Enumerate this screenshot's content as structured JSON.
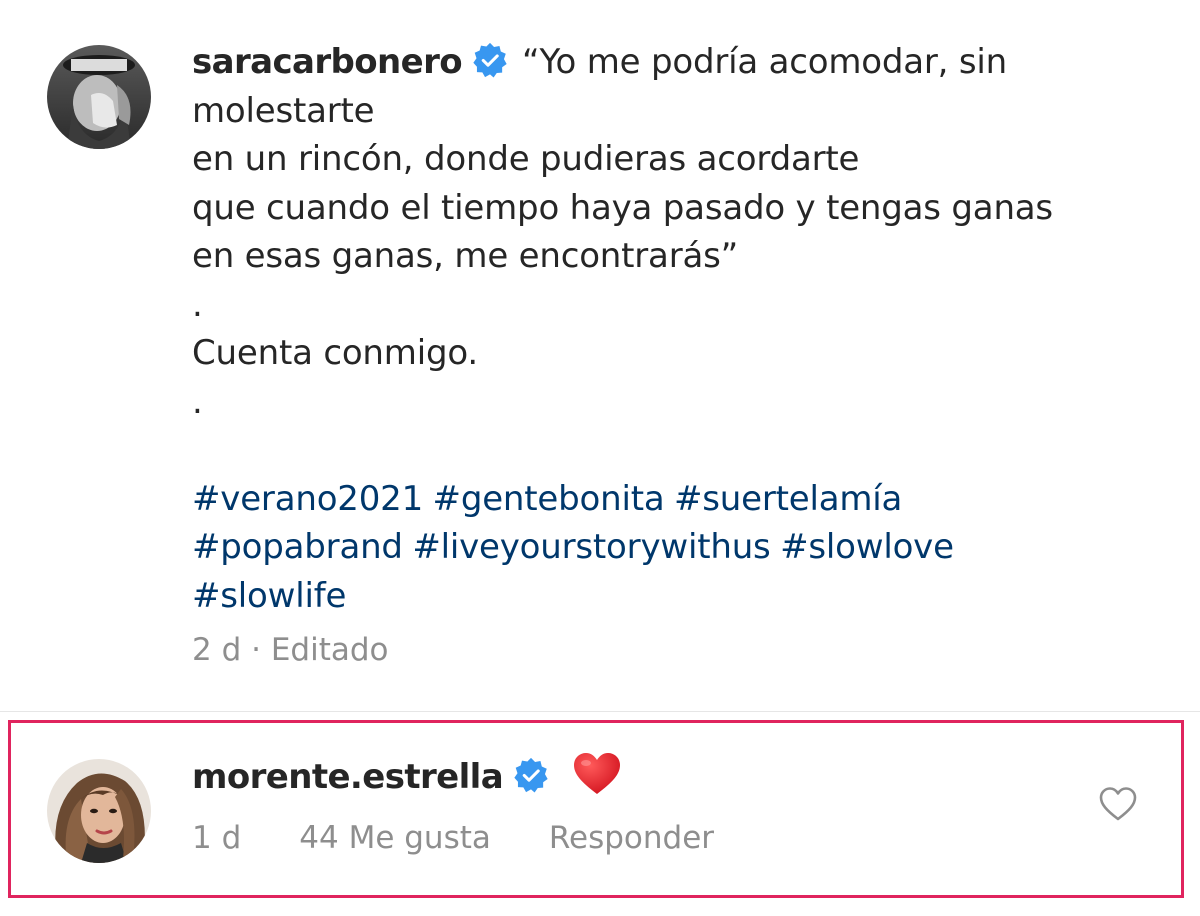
{
  "post": {
    "username": "saracarbonero",
    "caption_lines": [
      "“Yo me podría acomodar, sin",
      "molestarte",
      "en un rincón, donde pudieras acordarte",
      "que cuando el tiempo haya pasado y tengas ganas",
      "en esas ganas, me encontrarás”",
      ".",
      "Cuenta conmigo.",
      "."
    ],
    "hashtags": [
      "#verano2021",
      "#gentebonita",
      "#suertelamía",
      "#popabrand",
      "#liveyourstorywithus",
      "#slowlove",
      "#slowlife"
    ],
    "meta": "2 d · Editado"
  },
  "comment": {
    "username": "morente.estrella",
    "text_emoji": "heart",
    "time": "1 d",
    "likes": "44 Me gusta",
    "reply_label": "Responder",
    "highlight_color": "#e0245e"
  },
  "colors": {
    "verified": "#3897f0",
    "hashtag": "#00376b",
    "meta": "#8e8e8e",
    "text": "#262626"
  },
  "icons": {
    "verified": "verified-badge-icon",
    "like": "heart-outline-icon",
    "emoji": "red-heart-emoji"
  }
}
